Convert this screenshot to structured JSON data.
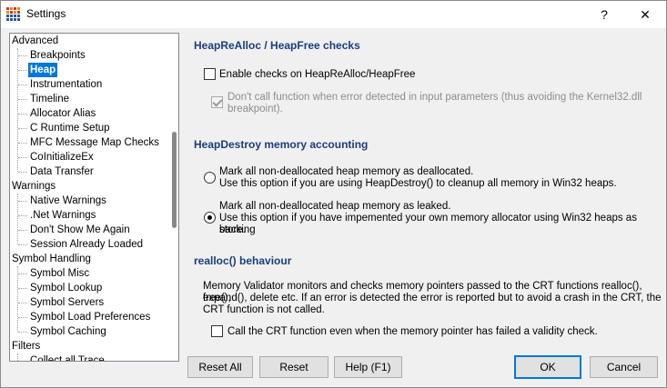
{
  "window": {
    "title": "Settings",
    "help_glyph": "?",
    "close_glyph": "✕"
  },
  "tree": {
    "items": [
      {
        "label": "Advanced",
        "level": 0
      },
      {
        "label": "Breakpoints",
        "level": 1
      },
      {
        "label": "Heap",
        "level": 1,
        "selected": true
      },
      {
        "label": "Instrumentation",
        "level": 1
      },
      {
        "label": "Timeline",
        "level": 1
      },
      {
        "label": "Allocator Alias",
        "level": 1
      },
      {
        "label": "C Runtime Setup",
        "level": 1
      },
      {
        "label": "MFC Message Map Checks",
        "level": 1
      },
      {
        "label": "CoInitializeEx",
        "level": 1
      },
      {
        "label": "Data Transfer",
        "level": 1
      },
      {
        "label": "Warnings",
        "level": 0
      },
      {
        "label": "Native Warnings",
        "level": 1
      },
      {
        "label": ".Net Warnings",
        "level": 1
      },
      {
        "label": "Don't Show Me Again",
        "level": 1
      },
      {
        "label": "Session Already Loaded",
        "level": 1
      },
      {
        "label": "Symbol Handling",
        "level": 0
      },
      {
        "label": "Symbol Misc",
        "level": 1
      },
      {
        "label": "Symbol Lookup",
        "level": 1
      },
      {
        "label": "Symbol Servers",
        "level": 1
      },
      {
        "label": "Symbol Load Preferences",
        "level": 1
      },
      {
        "label": "Symbol Caching",
        "level": 1
      },
      {
        "label": "Filters",
        "level": 0
      },
      {
        "label": "Collect all Trace",
        "level": 1
      }
    ]
  },
  "heaprealloc": {
    "heading": "HeapReAlloc / HeapFree checks",
    "enable_checks": {
      "label": "Enable checks on HeapReAlloc/HeapFree",
      "checked": false
    },
    "dont_call": {
      "label_line1": "Don't call function when error detected in input parameters (thus avoiding the Kernel32.dll",
      "label_line2": "breakpoint).",
      "checked": true,
      "enabled": false
    }
  },
  "heapdestroy": {
    "heading": "HeapDestroy memory accounting",
    "option_dealloc": {
      "line1": "Mark all non-deallocated heap memory as deallocated.",
      "line2": "Use this option if you are using HeapDestroy() to cleanup all memory in Win32 heaps.",
      "selected": false
    },
    "option_leaked": {
      "line1": "Mark all non-deallocated heap memory as leaked.",
      "line2": "Use this option if you have impemented your own memory allocator using Win32 heaps as backing",
      "line3": "store.",
      "selected": true
    }
  },
  "realloc": {
    "heading": "realloc() behaviour",
    "description_line1": "Memory Validator monitors and checks memory pointers passed to the CRT functions realloc(), free(),",
    "description_line2": "expand(), delete etc. If an error is detected the error is reported but to avoid a crash in the CRT, the",
    "description_line3": "CRT function is not called.",
    "call_crt": {
      "label": "Call the CRT function even when the memory pointer has failed a validity check.",
      "checked": false
    }
  },
  "buttons": {
    "reset_all": "Reset All",
    "reset": "Reset",
    "help": "Help (F1)",
    "ok": "OK",
    "cancel": "Cancel"
  },
  "colors": {
    "selection": "#0078d7",
    "heading": "#1a3f7a"
  }
}
